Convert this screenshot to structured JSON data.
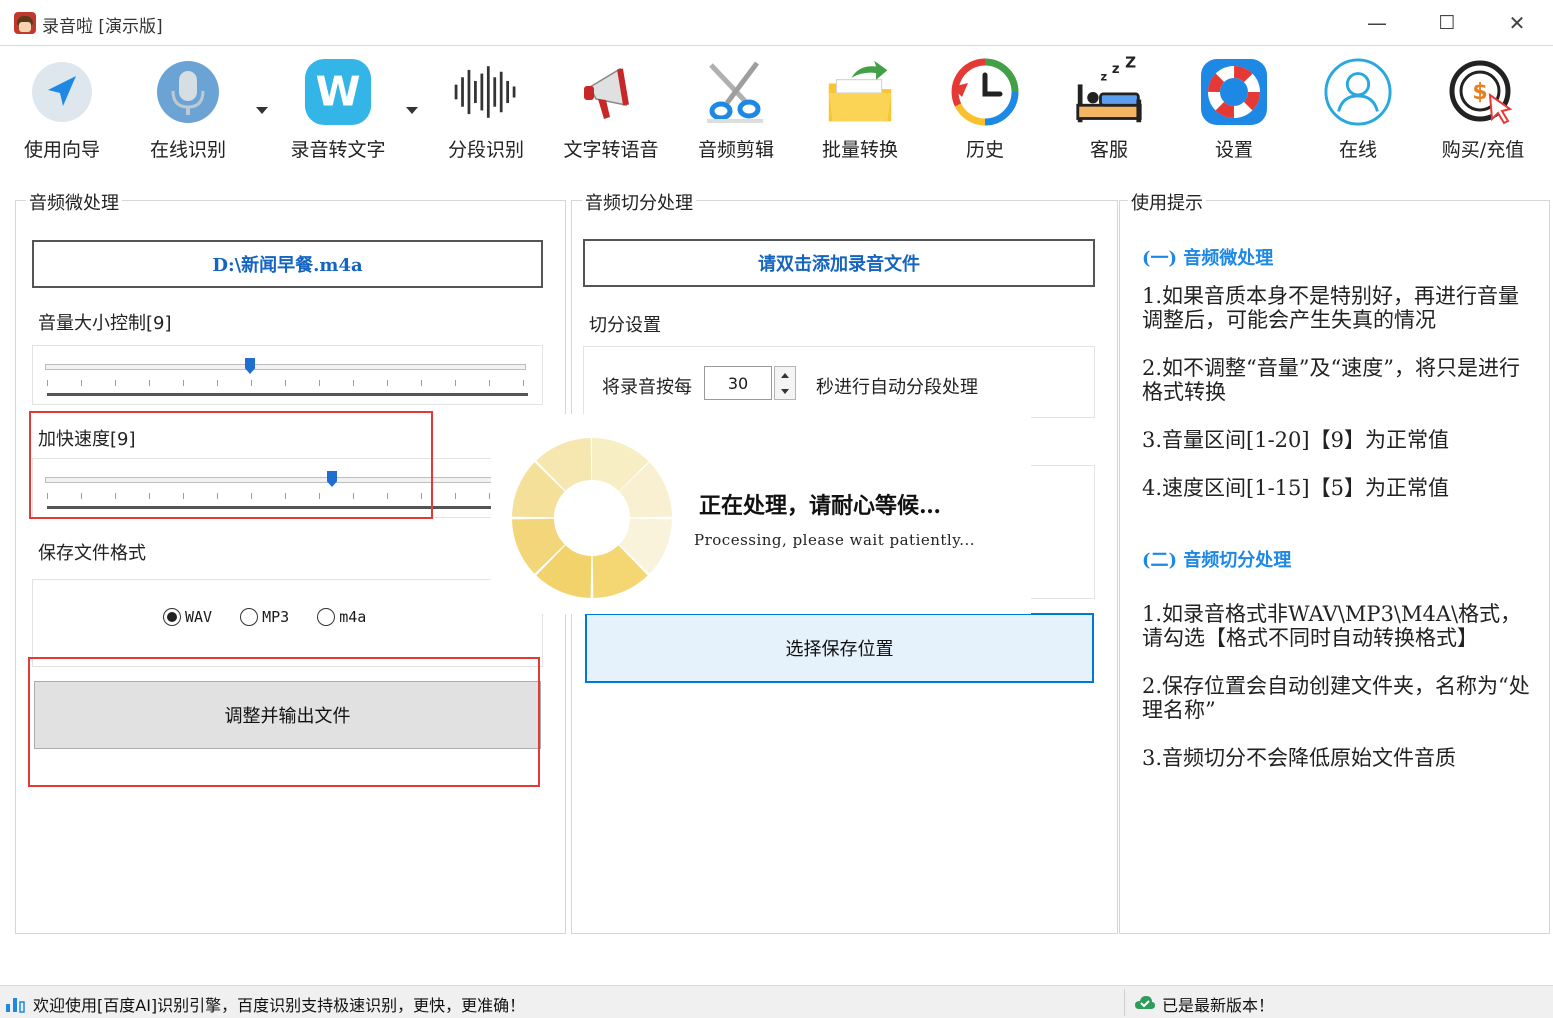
{
  "window": {
    "title": "录音啦 [演示版]",
    "minimize": "—",
    "maximize": "☐",
    "close": "✕"
  },
  "toolbar": {
    "items": [
      {
        "label": "使用向导",
        "icon": "navigation-arrow-icon"
      },
      {
        "label": "在线识别",
        "icon": "microphone-icon"
      },
      {
        "label": "录音转文字",
        "icon": "w-badge-icon"
      },
      {
        "label": "分段识别",
        "icon": "waveform-icon"
      },
      {
        "label": "文字转语音",
        "icon": "megaphone-icon"
      },
      {
        "label": "音频剪辑",
        "icon": "scissors-icon"
      },
      {
        "label": "批量转换",
        "icon": "folder-convert-icon"
      },
      {
        "label": "历史",
        "icon": "history-clock-icon"
      },
      {
        "label": "客服",
        "icon": "sleeping-bed-icon"
      },
      {
        "label": "设置",
        "icon": "lifebuoy-icon"
      },
      {
        "label": "在线",
        "icon": "user-circle-icon"
      },
      {
        "label": "购买/充值",
        "icon": "coin-purchase-icon"
      }
    ]
  },
  "micro": {
    "title": "音频微处理",
    "file_path": "D:\\新闻早餐.m4a",
    "volume_label": "音量大小控制[9]",
    "volume_value": 9,
    "speed_label": "加快速度[9]",
    "speed_value": 9,
    "format_label": "保存文件格式",
    "formats": [
      "WAV",
      "MP3",
      "m4a"
    ],
    "selected_format": "WAV",
    "output_button": "调整并输出文件"
  },
  "split": {
    "title": "音频切分处理",
    "add_file": "请双击添加录音文件",
    "settings_label": "切分设置",
    "prefix": "将录音按每",
    "seconds": "30",
    "suffix": "秒进行自动分段处理",
    "save_location": "选择保存位置"
  },
  "tips": {
    "title": "使用提示",
    "section1_title": "(一) 音频微处理",
    "section1": [
      "1.如果音质本身不是特别好，再进行音量调整后，可能会产生失真的情况",
      "2.如不调整“音量”及“速度”，将只是进行格式转换",
      "3.音量区间[1-20]【9】为正常值",
      "4.速度区间[1-15]【5】为正常值"
    ],
    "section2_title": "(二) 音频切分处理",
    "section2": [
      "1.如录音格式非WAV\\MP3\\M4A\\格式，请勾选【格式不同时自动转换格式】",
      "2.保存位置会自动创建文件夹，名称为“处理名称”",
      "3.音频切分不会降低原始文件音质"
    ]
  },
  "processing": {
    "title": "正在处理，请耐心等候…",
    "subtitle": "Processing, please wait patiently..."
  },
  "status": {
    "left": "欢迎使用[百度AI]识别引擎，百度识别支持极速识别，更快，更准确！",
    "right": "已是最新版本！"
  },
  "colors": {
    "accent": "#1e88e5",
    "highlight_red": "#e53935",
    "spinner": "#f2d26b"
  }
}
